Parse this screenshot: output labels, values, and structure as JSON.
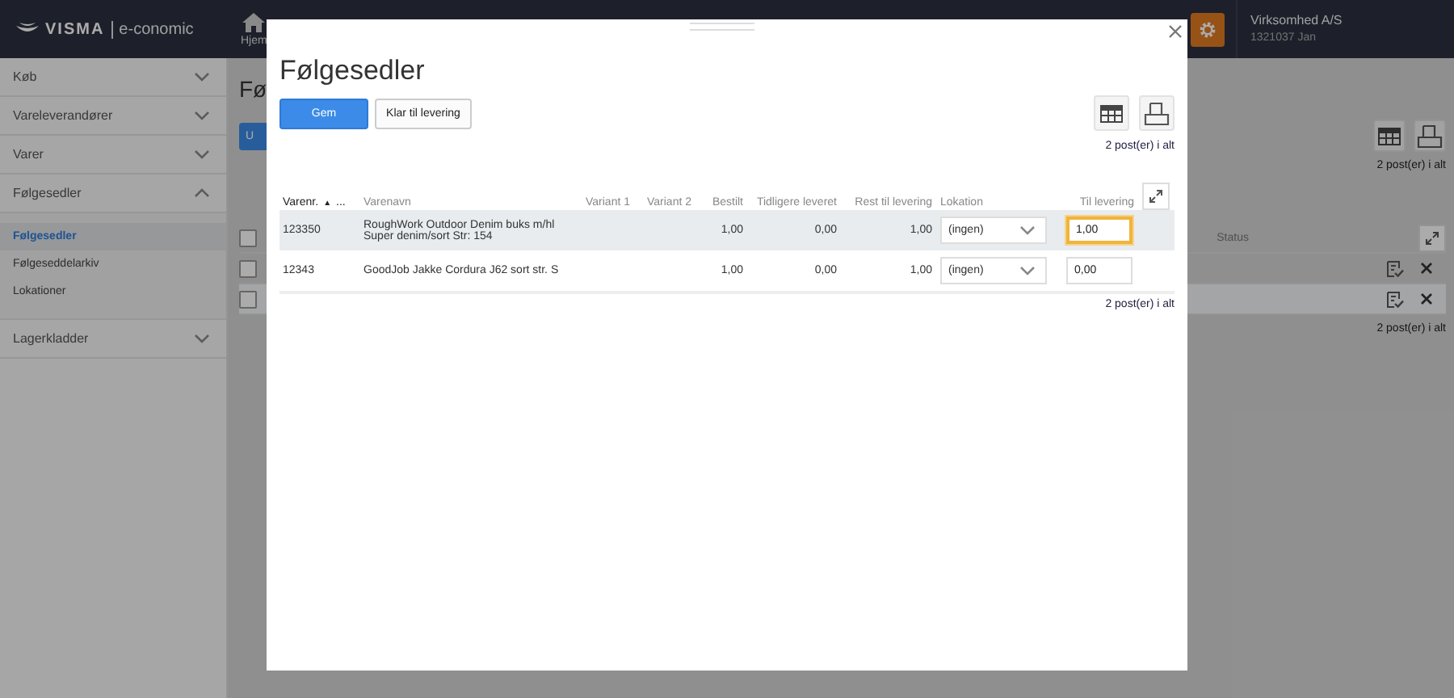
{
  "topbar": {
    "logo": "VISMA",
    "product": "e-conomic",
    "nav": [
      {
        "label": "Hjem",
        "selected": false
      }
    ],
    "company": "Virksomhed A/S",
    "user": "1321037 Jan"
  },
  "sidebar": {
    "items": [
      {
        "label": "Køb",
        "expanded": false
      },
      {
        "label": "Vareleverandører",
        "expanded": false
      },
      {
        "label": "Varer",
        "expanded": false
      },
      {
        "label": "Følgesedler",
        "expanded": true,
        "children": [
          {
            "label": "Følgesedler",
            "selected": true
          },
          {
            "label": "Følgeseddelarkiv",
            "selected": false
          },
          {
            "label": "Lokationer",
            "selected": false
          }
        ]
      },
      {
        "label": "Lagerkladder",
        "expanded": false
      }
    ]
  },
  "page": {
    "title": "Fø",
    "primary_button": "U",
    "count": "2 post(er) i alt",
    "columns": [
      "Status"
    ],
    "header_checked": false,
    "rows": [
      {
        "checked": false,
        "selected": false
      },
      {
        "checked": false,
        "selected": true
      }
    ],
    "footer_count": "2 post(er) i alt"
  },
  "dialog": {
    "title": "Følgesedler",
    "buttons": [
      {
        "label": "Gem",
        "kind": "primary"
      },
      {
        "label": "Klar til levering",
        "kind": "secondary"
      }
    ],
    "count": "2 post(er) i alt",
    "columns": [
      {
        "label": "Varenr.",
        "kind": "text",
        "sort_arrow": "▲",
        "more": "..."
      },
      {
        "label": "Varenavn",
        "kind": "text"
      },
      {
        "label": "Variant 1",
        "kind": "number"
      },
      {
        "label": "Variant 2",
        "kind": "number"
      },
      {
        "label": "Bestilt",
        "kind": "number"
      },
      {
        "label": "Tidligere leveret",
        "kind": "number"
      },
      {
        "label": "Rest til levering",
        "kind": "number"
      },
      {
        "label": "Lokation",
        "kind": "text"
      },
      {
        "label": "Til levering",
        "kind": "number"
      }
    ],
    "rows": [
      {
        "selected": true,
        "cells": [
          "123350",
          "RoughWork Outdoor Denim buks m/hl\nSuper denim/sort Str: 154",
          "",
          "",
          "1,00",
          "0,00",
          "1,00"
        ],
        "location": "(ingen)",
        "quantity": "1,00",
        "focused": true
      },
      {
        "selected": false,
        "cells": [
          "12343",
          "GoodJob Jakke Cordura J62 sort str. S",
          "",
          "",
          "1,00",
          "0,00",
          "1,00"
        ],
        "location": "(ingen)",
        "quantity": "0,00",
        "focused": false
      }
    ],
    "footer_count": "2 post(er) i alt"
  }
}
